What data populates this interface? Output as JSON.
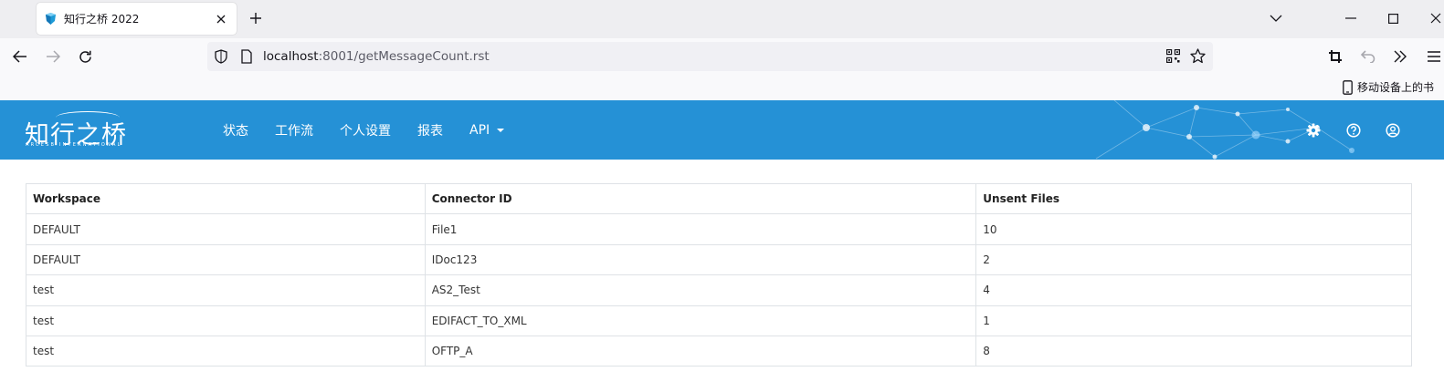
{
  "browser": {
    "tab_title": "知行之桥 2022",
    "url_host": "localhost",
    "url_rest": ":8001/getMessageCount.rst",
    "bookmark_label": "移动设备上的书"
  },
  "app": {
    "logo_text": "知行之桥",
    "logo_sub": "ARCESB INTERNATIONAL",
    "menu": [
      {
        "label": "状态"
      },
      {
        "label": "工作流"
      },
      {
        "label": "个人设置"
      },
      {
        "label": "报表"
      },
      {
        "label": "API"
      }
    ]
  },
  "table": {
    "headers": [
      "Workspace",
      "Connector ID",
      "Unsent Files"
    ],
    "rows": [
      [
        "DEFAULT",
        "File1",
        "10"
      ],
      [
        "DEFAULT",
        "IDoc123",
        "2"
      ],
      [
        "test",
        "AS2_Test",
        "4"
      ],
      [
        "test",
        "EDIFACT_TO_XML",
        "1"
      ],
      [
        "test",
        "OFTP_A",
        "8"
      ]
    ]
  },
  "colors": {
    "header_bg": "#2591d6",
    "tabstrip_bg": "#eeeef1",
    "navbar_bg": "#f9f9fb"
  }
}
